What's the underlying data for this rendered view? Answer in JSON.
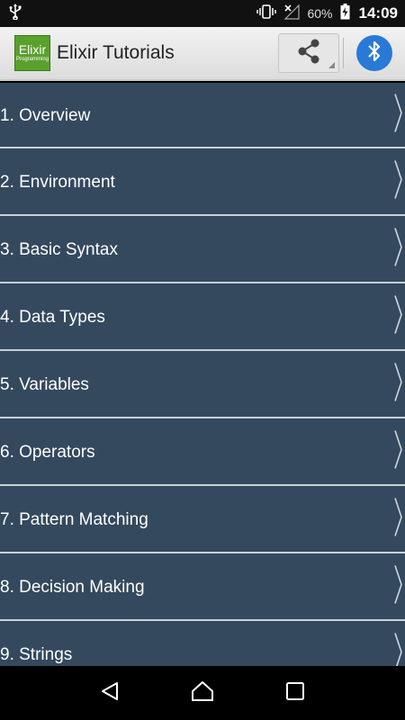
{
  "status_bar": {
    "battery_percent": "60%",
    "time": "14:09",
    "icons": [
      "usb-icon",
      "vibrate-icon",
      "no-signal-icon",
      "battery-charging-icon"
    ]
  },
  "app_bar": {
    "logo_text": "Elixir",
    "logo_subtext": "Programming",
    "title": "Elixir Tutorials",
    "actions": [
      "share-icon",
      "bluetooth-icon"
    ],
    "bluetooth_color": "#2979d6"
  },
  "list": {
    "background_color": "#34495e",
    "items": [
      {
        "label": "1. Overview"
      },
      {
        "label": "2. Environment"
      },
      {
        "label": "3. Basic Syntax"
      },
      {
        "label": "4. Data Types"
      },
      {
        "label": "5. Variables"
      },
      {
        "label": "6. Operators"
      },
      {
        "label": "7. Pattern Matching"
      },
      {
        "label": "8. Decision Making"
      },
      {
        "label": "9. Strings"
      }
    ]
  },
  "nav_bar": {
    "buttons": [
      "back-icon",
      "home-icon",
      "recents-icon"
    ]
  }
}
